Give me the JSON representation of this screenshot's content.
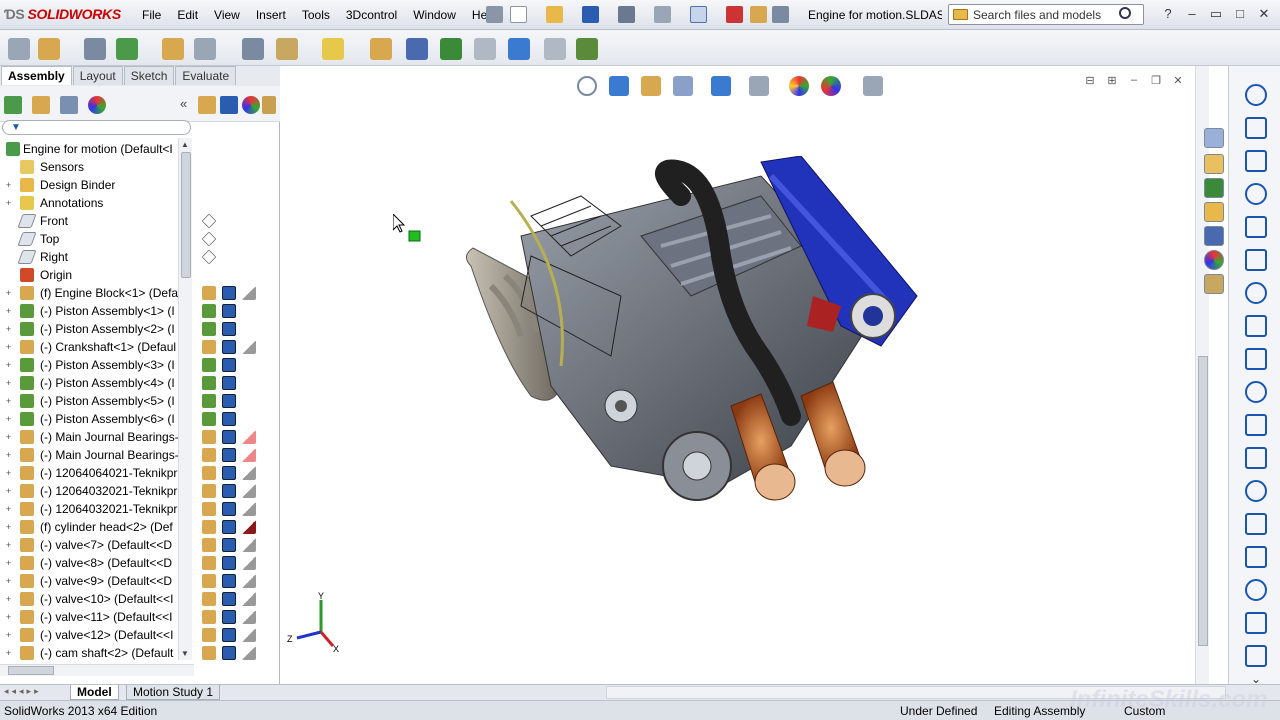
{
  "app": {
    "logo_prefix": "ƊS",
    "logo_text": "SOLIDWORKS",
    "document_title": "Engine for motion.SLDAS...",
    "menus": [
      "File",
      "Edit",
      "View",
      "Insert",
      "Tools",
      "3Dcontrol",
      "Window",
      "Help"
    ],
    "search_placeholder": "Search files and models"
  },
  "tabs": [
    {
      "label": "Assembly",
      "active": true
    },
    {
      "label": "Layout",
      "active": false
    },
    {
      "label": "Sketch",
      "active": false
    },
    {
      "label": "Evaluate",
      "active": false
    }
  ],
  "tree": {
    "root": "Engine for motion  (Default<I",
    "items": [
      {
        "label": "Sensors",
        "icon": "sensor-icon",
        "expand": false
      },
      {
        "label": "Design Binder",
        "icon": "binder-icon",
        "expand": true
      },
      {
        "label": "Annotations",
        "icon": "annotation-icon",
        "expand": true
      },
      {
        "label": "Front",
        "icon": "plane-icon",
        "expand": false
      },
      {
        "label": "Top",
        "icon": "plane-icon",
        "expand": false
      },
      {
        "label": "Right",
        "icon": "plane-icon",
        "expand": false
      },
      {
        "label": "Origin",
        "icon": "origin-icon",
        "expand": false
      },
      {
        "label": "(f) Engine Block<1> (Defa",
        "icon": "part-icon",
        "expand": true
      },
      {
        "label": "(-) Piston Assembly<1> (I",
        "icon": "subassembly-icon",
        "expand": true
      },
      {
        "label": "(-) Piston Assembly<2> (I",
        "icon": "subassembly-icon",
        "expand": true
      },
      {
        "label": "(-) Crankshaft<1> (Defaul",
        "icon": "part-icon",
        "expand": true
      },
      {
        "label": "(-) Piston Assembly<3> (I",
        "icon": "subassembly-icon",
        "expand": true
      },
      {
        "label": "(-) Piston Assembly<4> (I",
        "icon": "subassembly-icon",
        "expand": true
      },
      {
        "label": "(-) Piston Assembly<5> (I",
        "icon": "subassembly-icon",
        "expand": true
      },
      {
        "label": "(-) Piston Assembly<6> (I",
        "icon": "subassembly-icon",
        "expand": true
      },
      {
        "label": "(-) Main Journal Bearings-",
        "icon": "part-icon",
        "expand": true
      },
      {
        "label": "(-) Main Journal Bearings-",
        "icon": "part-icon",
        "expand": true
      },
      {
        "label": "(-) 12064064021-Teknikpr",
        "icon": "part-icon",
        "expand": true
      },
      {
        "label": "(-) 12064032021-Teknikpr",
        "icon": "part-icon",
        "expand": true
      },
      {
        "label": "(-) 12064032021-Teknikpr",
        "icon": "part-icon",
        "expand": true
      },
      {
        "label": "(f) cylinder head<2> (Def",
        "icon": "part-icon",
        "expand": true
      },
      {
        "label": "(-) valve<7> (Default<<D",
        "icon": "part-icon",
        "expand": true
      },
      {
        "label": "(-) valve<8> (Default<<D",
        "icon": "part-icon",
        "expand": true
      },
      {
        "label": "(-) valve<9> (Default<<D",
        "icon": "part-icon",
        "expand": true
      },
      {
        "label": "(-) valve<10> (Default<<I",
        "icon": "part-icon",
        "expand": true
      },
      {
        "label": "(-) valve<11> (Default<<I",
        "icon": "part-icon",
        "expand": true
      },
      {
        "label": "(-) valve<12> (Default<<I",
        "icon": "part-icon",
        "expand": true
      },
      {
        "label": "(-) cam shaft<2> (Default",
        "icon": "part-icon",
        "expand": true
      }
    ]
  },
  "bottom_tabs": [
    {
      "label": "Model",
      "active": true
    },
    {
      "label": "Motion Study 1",
      "active": false
    }
  ],
  "status": {
    "edition": "SolidWorks 2013 x64 Edition",
    "definition": "Under Defined",
    "mode": "Editing Assembly",
    "units": "Custom"
  },
  "triad": {
    "y": "Y",
    "z": "Z",
    "x": "X"
  },
  "watermark": "InfiniteSkills.com",
  "colors": {
    "accent_blue": "#2a5db0",
    "brand_red": "#cc0000",
    "engine_blue": "#2233bb",
    "air_filter": "#c8662a"
  }
}
